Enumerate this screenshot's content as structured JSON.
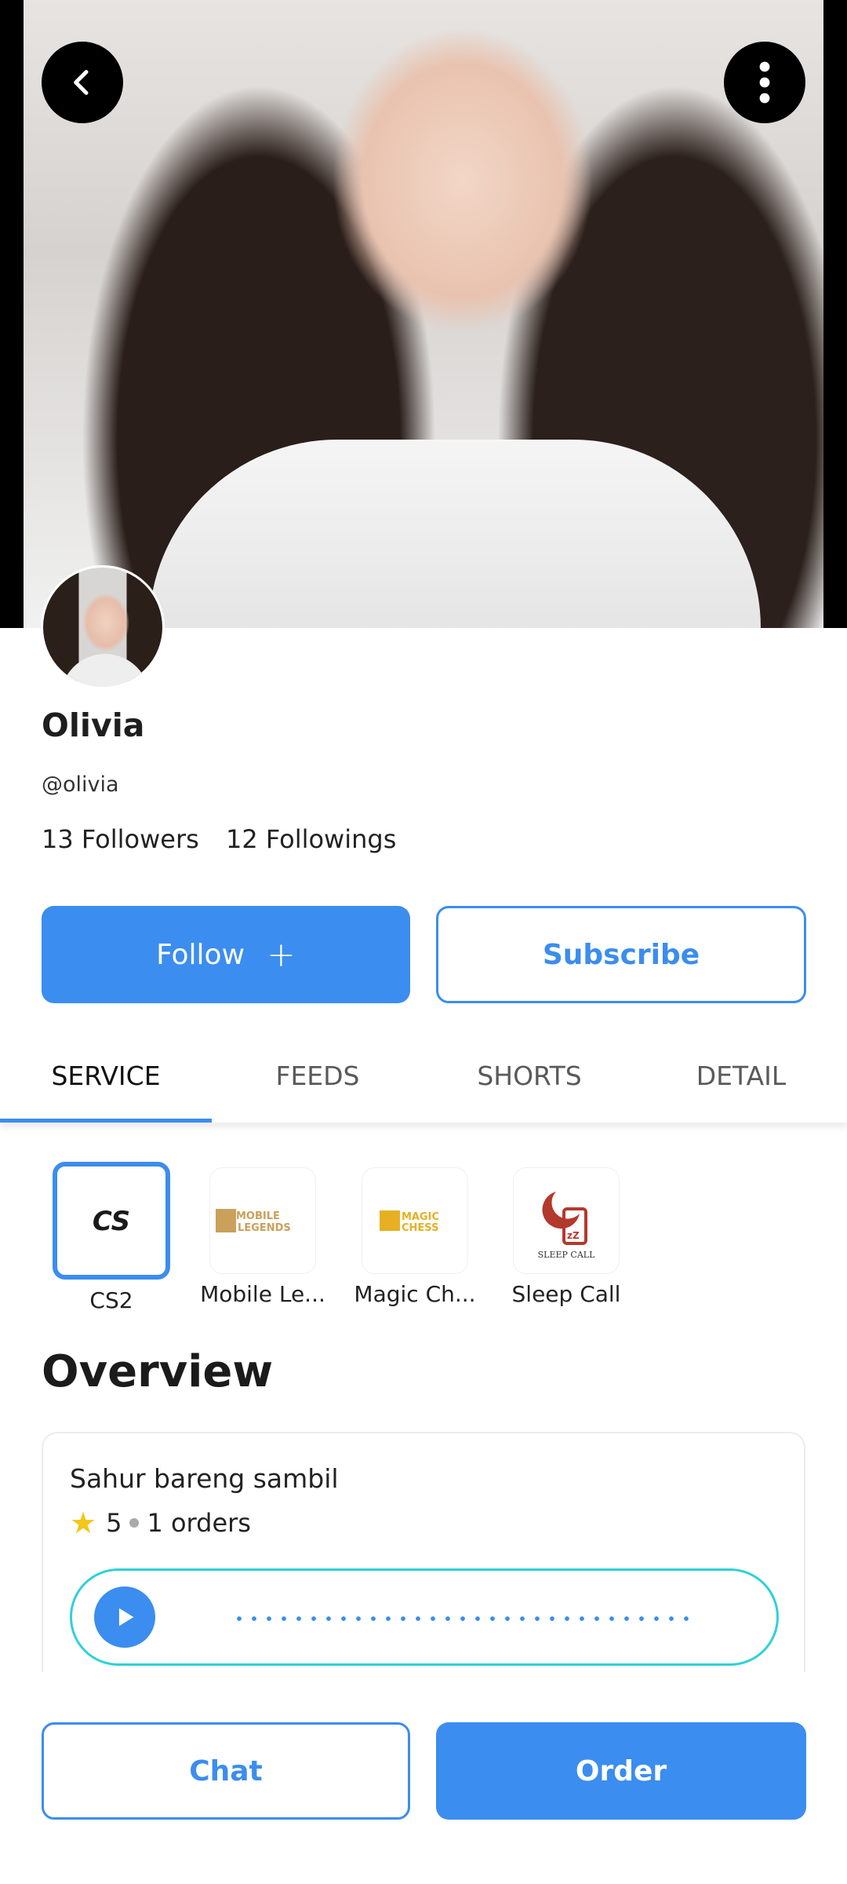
{
  "profile": {
    "name": "Olivia",
    "handle": "@olivia",
    "followers": "13 Followers",
    "followings": "12 Followings"
  },
  "actions": {
    "follow_label": "Follow",
    "follow_icon": "plus-icon",
    "subscribe_label": "Subscribe"
  },
  "tabs": [
    {
      "label": "SERVICE",
      "active": true
    },
    {
      "label": "FEEDS",
      "active": false
    },
    {
      "label": "SHORTS",
      "active": false
    },
    {
      "label": "DETAIL",
      "active": false
    }
  ],
  "services": [
    {
      "label": "CS2",
      "logo": "CS",
      "selected": true
    },
    {
      "label": "Mobile Le...",
      "logo": "MOBILE LEGENDS",
      "selected": false
    },
    {
      "label": "Magic Ch...",
      "logo": "MAGIC CHESS",
      "selected": false
    },
    {
      "label": "Sleep Call",
      "logo": "SLEEP CALL",
      "selected": false
    }
  ],
  "overview": {
    "title": "Overview",
    "card": {
      "title": "Sahur bareng sambil",
      "rating": "5",
      "orders": "1 orders"
    }
  },
  "bottom": {
    "chat_label": "Chat",
    "order_label": "Order"
  },
  "colors": {
    "accent": "#3b8def",
    "audio_border": "#2fd1d6",
    "star": "#f5c518"
  }
}
